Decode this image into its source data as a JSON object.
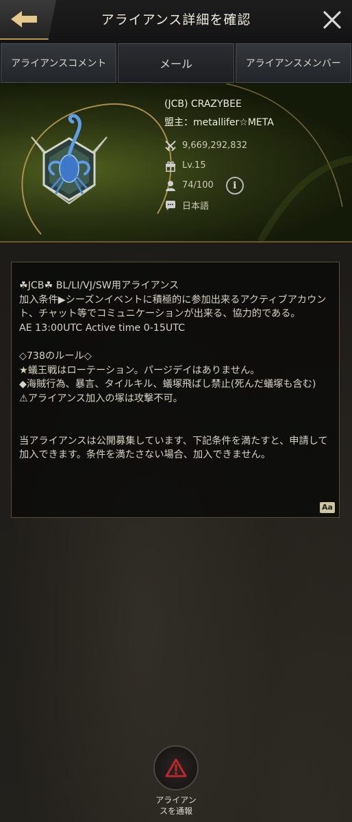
{
  "header": {
    "title": "アライアンス詳細を確認",
    "back_icon": "back-arrow-icon",
    "close_icon": "close-icon"
  },
  "tabs": [
    {
      "label": "アライアンスコメント"
    },
    {
      "label": "メール"
    },
    {
      "label": "アライアンスメンバー"
    }
  ],
  "alliance": {
    "name": "(JCB) CRAZYBEE",
    "leader": "盟主：metallifer☆META",
    "power": "9,669,292,832",
    "level": "Lv.15",
    "members": "74/100",
    "language": "日本語",
    "emblem_icon": "scorpion-emblem-icon"
  },
  "description": {
    "text": "☘JCB☘ BL/LI/VJ/SW用アライアンス\n加入条件▶シーズンイベントに積極的に参加出来るアクティブアカウント、チャット等でコミュニケーションが出来る、協力的である。\nAE 13:00UTC Active time 0-15UTC\n\n◇738のルール◇\n★蟻王戦はローテーション。パージデイはありません。\n◆海賊行為、暴言、タイルキル、蟻塚飛ばし禁止(死んだ蟻塚も含む)\n⚠アライアンス加入の塚は攻撃不可。\n\n\n当アライアンスは公開募集しています、下記条件を満たすと、申請して加入できます。条件を満たさない場合、加入できません。",
    "translate_label": "Aa"
  },
  "report": {
    "label": "アライアン\nスを通報"
  },
  "colors": {
    "accent_gold": "#b89a52",
    "report_red": "#c0282a"
  }
}
